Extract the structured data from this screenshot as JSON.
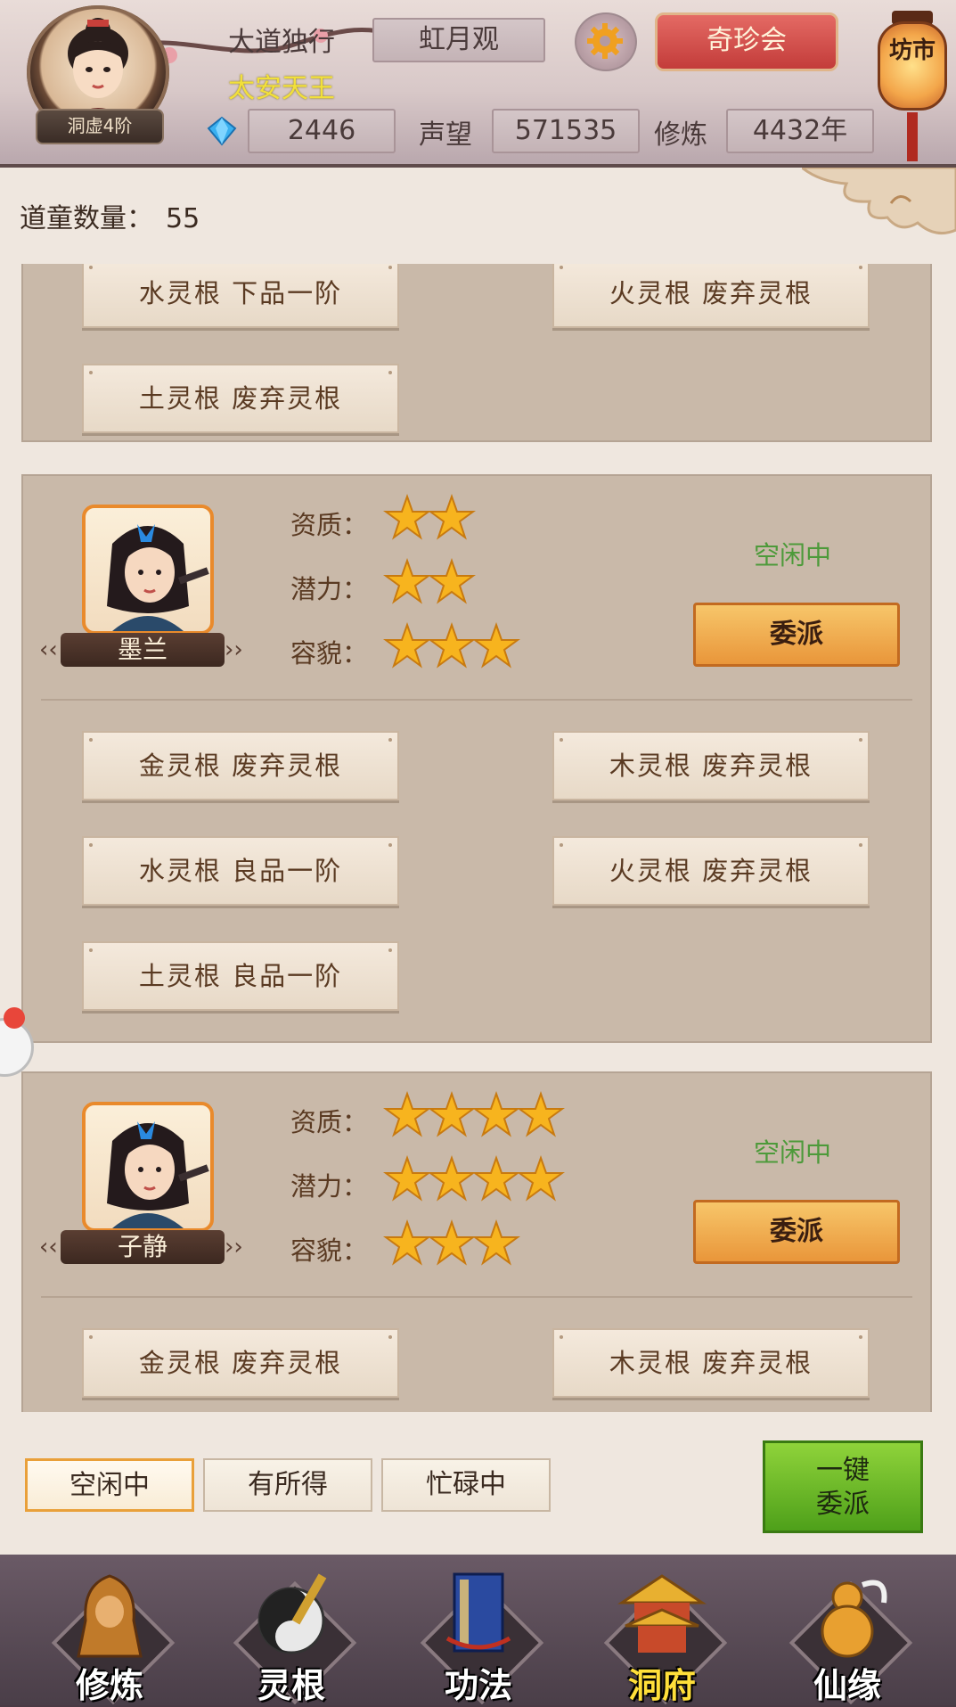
{
  "header": {
    "player_name": "大道独行",
    "player_title": "太安天王",
    "realm": "洞虚4阶",
    "sect": "虹月观",
    "qizhen_label": "奇珍会",
    "market_label": "坊市",
    "gems": "2446",
    "fame_label": "声望",
    "fame": "571535",
    "cultivation_label": "修炼",
    "cultivation": "4432年"
  },
  "panel": {
    "count_label": "道童数量：",
    "count_value": "55"
  },
  "cards": [
    {
      "partial": true,
      "roots": [
        "水灵根 下品一阶",
        "火灵根 废弃灵根",
        "土灵根 废弃灵根"
      ]
    },
    {
      "name": "墨兰",
      "status": "空闲中",
      "assign_label": "委派",
      "attributes": [
        {
          "label": "资质：",
          "stars": 2
        },
        {
          "label": "潜力：",
          "stars": 2
        },
        {
          "label": "容貌：",
          "stars": 3
        }
      ],
      "roots": [
        "金灵根 废弃灵根",
        "木灵根 废弃灵根",
        "水灵根 良品一阶",
        "火灵根 废弃灵根",
        "土灵根 良品一阶"
      ]
    },
    {
      "name": "子静",
      "status": "空闲中",
      "assign_label": "委派",
      "attributes": [
        {
          "label": "资质：",
          "stars": 4
        },
        {
          "label": "潜力：",
          "stars": 4
        },
        {
          "label": "容貌：",
          "stars": 3
        }
      ],
      "roots": [
        "金灵根 废弃灵根",
        "木灵根 废弃灵根"
      ]
    }
  ],
  "filters": {
    "tabs": [
      "空闲中",
      "有所得",
      "忙碌中"
    ],
    "active": 0,
    "onekey_line1": "一键",
    "onekey_line2": "委派"
  },
  "nav": {
    "items": [
      "修炼",
      "灵根",
      "功法",
      "洞府",
      "仙缘"
    ],
    "active": 3
  },
  "colors": {
    "accent_orange": "#e98a2c",
    "status_green": "#4d9a3a",
    "title_yellow": "#f2e03a",
    "button_red": "#c33c3a",
    "onekey_green": "#4ea01a"
  }
}
